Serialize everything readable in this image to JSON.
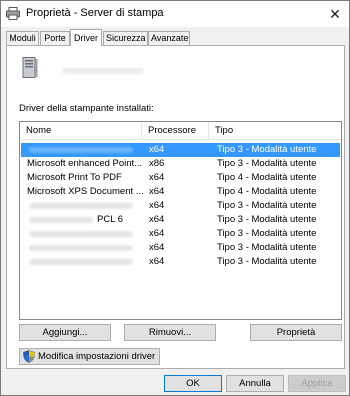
{
  "window": {
    "title": "Proprietà - Server di stampa",
    "close_glyph": "✕"
  },
  "tabs": [
    {
      "label": "Moduli"
    },
    {
      "label": "Porte"
    },
    {
      "label": "Driver"
    },
    {
      "label": "Sicurezza"
    },
    {
      "label": "Avanzate"
    }
  ],
  "active_tab": "Driver",
  "drivers_section": {
    "label": "Driver della stampante installati:",
    "columns": {
      "name": "Nome",
      "processor": "Processore",
      "type": "Tipo"
    },
    "rows": [
      {
        "name": "",
        "processor": "x64",
        "type": "Tipo 3 - Modalità utente",
        "selected": true
      },
      {
        "name": "Microsoft enhanced Point...",
        "processor": "x86",
        "type": "Tipo 3 - Modalità utente"
      },
      {
        "name": "Microsoft Print To PDF",
        "processor": "x64",
        "type": "Tipo 4 - Modalità utente"
      },
      {
        "name": "Microsoft XPS Document ...",
        "processor": "x64",
        "type": "Tipo 4 - Modalità utente"
      },
      {
        "name": "",
        "processor": "x64",
        "type": "Tipo 3 - Modalità utente"
      },
      {
        "name": "PCL 6",
        "processor": "x64",
        "type": "Tipo 3 - Modalità utente"
      },
      {
        "name": "",
        "processor": "x64",
        "type": "Tipo 3 - Modalità utente"
      },
      {
        "name": "",
        "processor": "x64",
        "type": "Tipo 3 - Modalità utente"
      },
      {
        "name": "",
        "processor": "x64",
        "type": "Tipo 3 - Modalità utente"
      }
    ]
  },
  "buttons": {
    "add": "Aggiungi...",
    "remove": "Rimuovi...",
    "properties": "Proprietà",
    "change_settings": "Modifica impostazioni driver",
    "ok": "OK",
    "cancel": "Annulla",
    "apply": "Applica"
  },
  "colors": {
    "selection": "#3399ff",
    "dialog_bg": "#f0f0f0"
  }
}
